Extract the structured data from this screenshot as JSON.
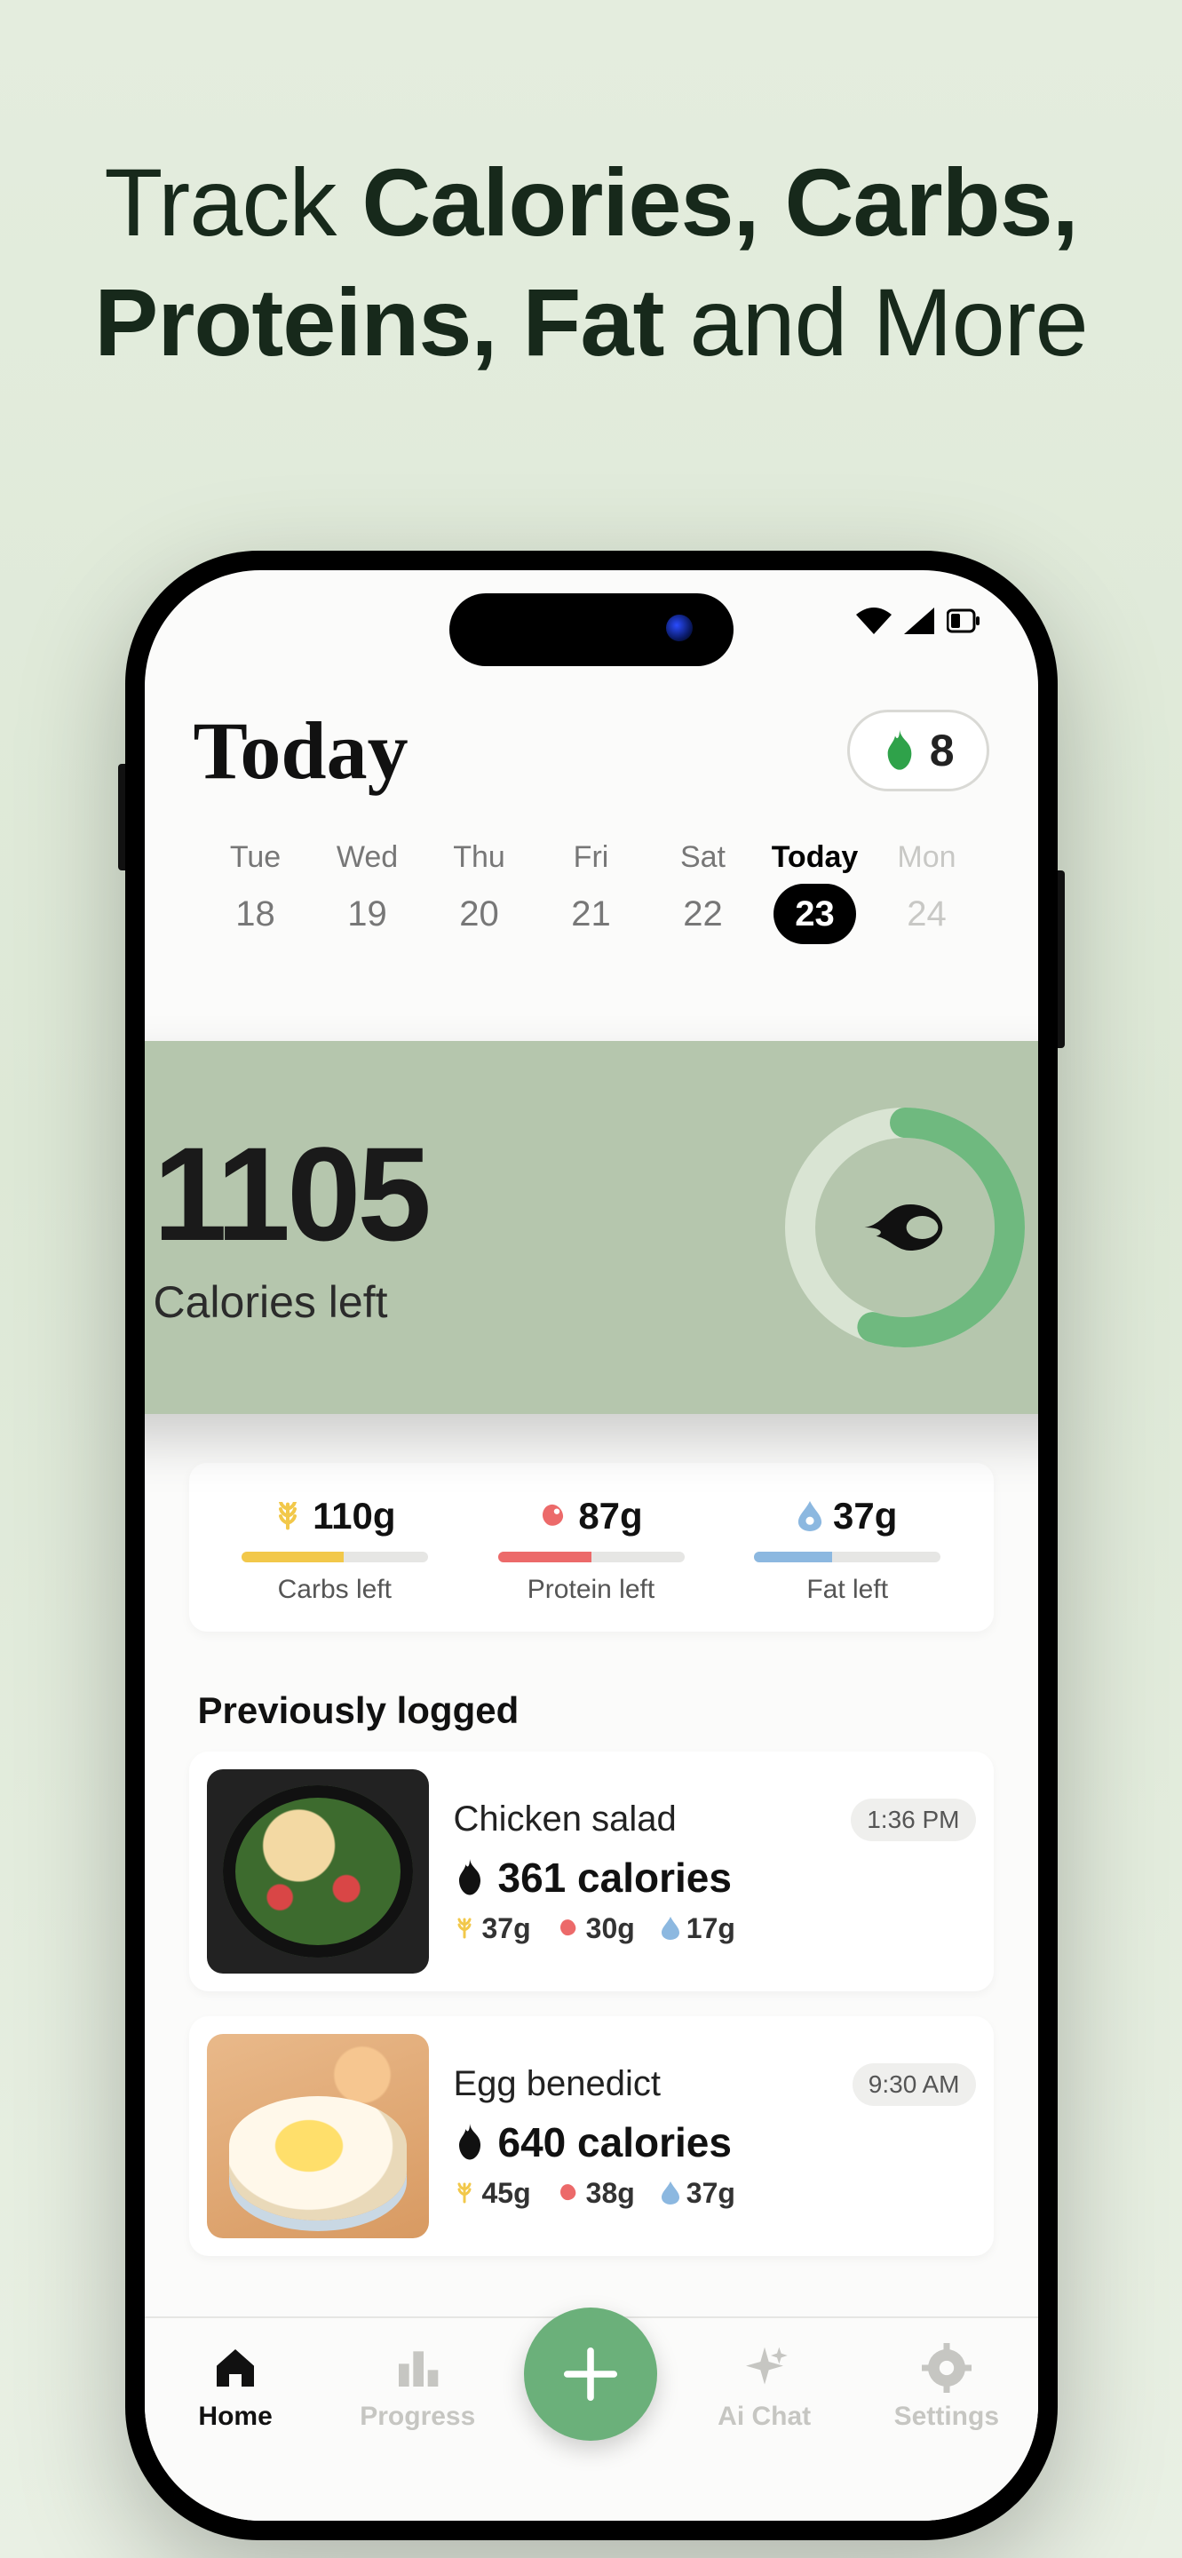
{
  "promo": {
    "line1_pre": "Track ",
    "line1_bold": "Calories, Carbs,",
    "line2_bold": "Proteins, Fat",
    "line2_post": " and More"
  },
  "header": {
    "title": "Today",
    "streak_count": "8"
  },
  "week": [
    {
      "name": "Tue",
      "num": "18",
      "state": "past"
    },
    {
      "name": "Wed",
      "num": "19",
      "state": "past"
    },
    {
      "name": "Thu",
      "num": "20",
      "state": "past"
    },
    {
      "name": "Fri",
      "num": "21",
      "state": "past"
    },
    {
      "name": "Sat",
      "num": "22",
      "state": "past"
    },
    {
      "name": "Today",
      "num": "23",
      "state": "today"
    },
    {
      "name": "Mon",
      "num": "24",
      "state": "future"
    }
  ],
  "calories": {
    "value": "1105",
    "label": "Calories left",
    "ring_percent": 55
  },
  "macros": {
    "carbs": {
      "value": "110g",
      "label": "Carbs left",
      "pct": 55,
      "color": "#f2c84a"
    },
    "protein": {
      "value": "87g",
      "label": "Protein left",
      "pct": 50,
      "color": "#ec6a6a"
    },
    "fat": {
      "value": "37g",
      "label": "Fat left",
      "pct": 42,
      "color": "#8cb8e0"
    }
  },
  "previously_logged": {
    "title": "Previously logged",
    "items": [
      {
        "name": "Chicken salad",
        "time": "1:36 PM",
        "calories": "361 calories",
        "carbs": "37g",
        "protein": "30g",
        "fat": "17g"
      },
      {
        "name": "Egg benedict",
        "time": "9:30 AM",
        "calories": "640 calories",
        "carbs": "45g",
        "protein": "38g",
        "fat": "37g"
      }
    ]
  },
  "tabs": {
    "home": "Home",
    "progress": "Progress",
    "aichat": "Ai Chat",
    "settings": "Settings"
  }
}
